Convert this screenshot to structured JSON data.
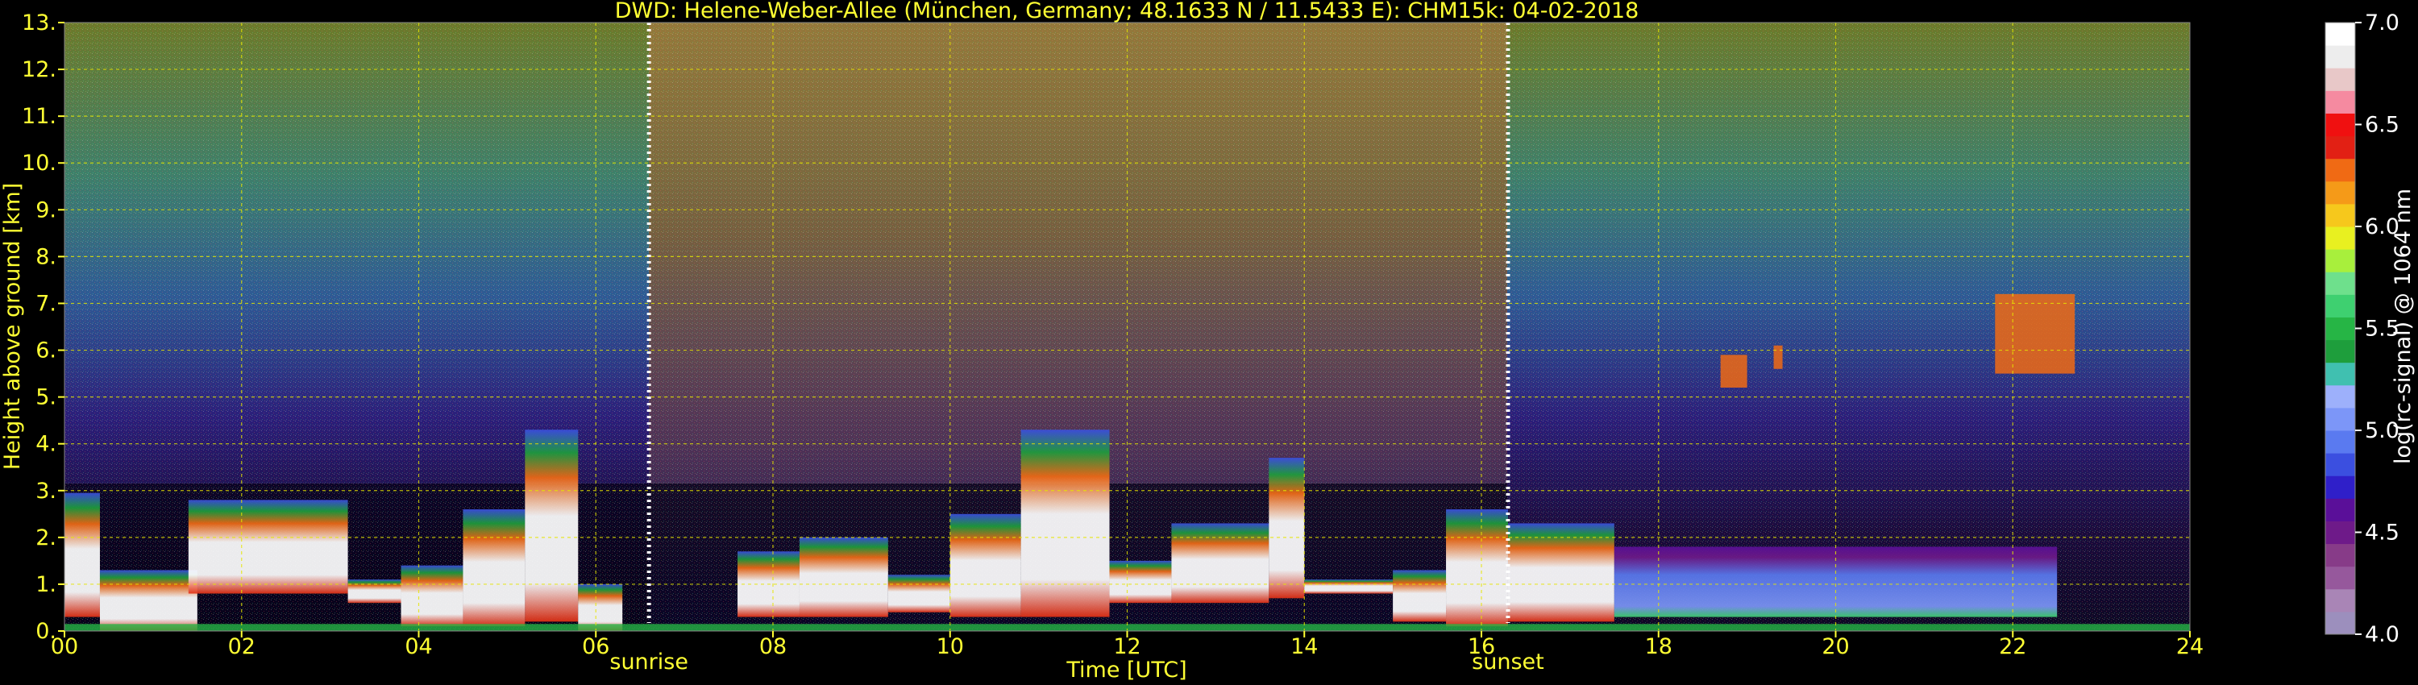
{
  "chart_data": {
    "type": "heatmap",
    "title": "DWD: Helene-Weber-Allee (München, Germany; 48.1633 N / 11.5433 E):    CHM15k: 04-02-2018",
    "xlabel": "Time [UTC]",
    "ylabel": "Height above ground [km]",
    "xlim": [
      0,
      24
    ],
    "ylim": [
      0,
      13
    ],
    "x_ticks": [
      "00",
      "02",
      "04",
      "06",
      "08",
      "10",
      "12",
      "14",
      "16",
      "18",
      "20",
      "22",
      "24"
    ],
    "y_ticks": [
      "0.",
      "1.",
      "2.",
      "3.",
      "4.",
      "5.",
      "6.",
      "7.",
      "8.",
      "9.",
      "10.",
      "11.",
      "12.",
      "13."
    ],
    "grid": true,
    "markers": [
      {
        "label": "sunrise",
        "time": 6.6
      },
      {
        "label": "sunset",
        "time": 16.3
      }
    ],
    "colorbar": {
      "label": "log(rc-signal) @ 1064 nm",
      "min": 4.0,
      "max": 7.0,
      "ticks": [
        "4.0",
        "4.5",
        "5.0",
        "5.5",
        "6.0",
        "6.5",
        "7.0"
      ],
      "colors": [
        "#9c8fbd",
        "#a985b6",
        "#96589c",
        "#873b88",
        "#6e1a89",
        "#5a0f99",
        "#2f1fc9",
        "#3b4fe0",
        "#5a7af0",
        "#7c96f8",
        "#9db0fb",
        "#40c0b0",
        "#1e9e3c",
        "#26b545",
        "#3ed070",
        "#6ee08c",
        "#a8ef3c",
        "#e8f020",
        "#f6c81c",
        "#f59a18",
        "#f06a14",
        "#e22014",
        "#f01010",
        "#f58aa0",
        "#e8c8c8",
        "#ededed",
        "#ffffff"
      ]
    },
    "cloud_layers": [
      {
        "t0": 0.0,
        "t1": 0.4,
        "base": 0.3,
        "top": 2.95
      },
      {
        "t0": 0.4,
        "t1": 1.5,
        "base": 0.0,
        "top": 1.3
      },
      {
        "t0": 1.4,
        "t1": 3.2,
        "base": 0.8,
        "top": 2.8
      },
      {
        "t0": 3.2,
        "t1": 3.8,
        "base": 0.6,
        "top": 1.1
      },
      {
        "t0": 3.8,
        "t1": 4.5,
        "base": 0.1,
        "top": 1.4
      },
      {
        "t0": 4.5,
        "t1": 5.2,
        "base": 0.1,
        "top": 2.6
      },
      {
        "t0": 5.2,
        "t1": 5.8,
        "base": 0.2,
        "top": 4.3
      },
      {
        "t0": 5.8,
        "t1": 6.3,
        "base": 0.0,
        "top": 1.0
      },
      {
        "t0": 7.6,
        "t1": 8.3,
        "base": 0.3,
        "top": 1.7
      },
      {
        "t0": 8.3,
        "t1": 9.3,
        "base": 0.3,
        "top": 2.0
      },
      {
        "t0": 9.3,
        "t1": 10.0,
        "base": 0.4,
        "top": 1.2
      },
      {
        "t0": 10.0,
        "t1": 10.8,
        "base": 0.3,
        "top": 2.5
      },
      {
        "t0": 10.8,
        "t1": 11.8,
        "base": 0.3,
        "top": 4.3
      },
      {
        "t0": 11.8,
        "t1": 12.5,
        "base": 0.6,
        "top": 1.5
      },
      {
        "t0": 12.5,
        "t1": 13.6,
        "base": 0.6,
        "top": 2.3
      },
      {
        "t0": 13.6,
        "t1": 14.0,
        "base": 0.7,
        "top": 3.7
      },
      {
        "t0": 14.0,
        "t1": 15.0,
        "base": 0.8,
        "top": 1.1
      },
      {
        "t0": 15.0,
        "t1": 15.6,
        "base": 0.2,
        "top": 1.3
      },
      {
        "t0": 15.6,
        "t1": 16.3,
        "base": 0.1,
        "top": 2.6
      },
      {
        "t0": 16.3,
        "t1": 17.5,
        "base": 0.2,
        "top": 2.3
      },
      {
        "t0": 17.5,
        "t1": 22.5,
        "base": 0.3,
        "top": 1.8
      }
    ],
    "high_clouds": [
      {
        "t0": 21.8,
        "t1": 22.7,
        "base": 5.5,
        "top": 7.2
      },
      {
        "t0": 18.7,
        "t1": 19.0,
        "base": 5.2,
        "top": 5.9
      },
      {
        "t0": 19.3,
        "t1": 19.4,
        "base": 5.6,
        "top": 6.1
      }
    ]
  }
}
